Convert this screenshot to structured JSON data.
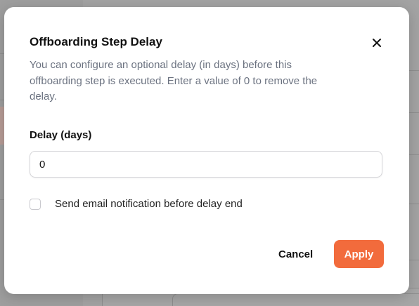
{
  "dialog": {
    "title": "Offboarding Step Delay",
    "description": "You can configure an optional delay (in days) before this offboarding step is executed. Enter a value of 0 to remove the delay.",
    "close_icon": "close-icon",
    "delay_label": "Delay (days)",
    "delay_value": "0",
    "notify_checkbox_checked": false,
    "notify_label": "Send email notification before delay end",
    "cancel_label": "Cancel",
    "apply_label": "Apply"
  },
  "colors": {
    "accent": "#f26b3c",
    "overlay": "#a3a3a3",
    "muted_text": "#6b7280"
  }
}
